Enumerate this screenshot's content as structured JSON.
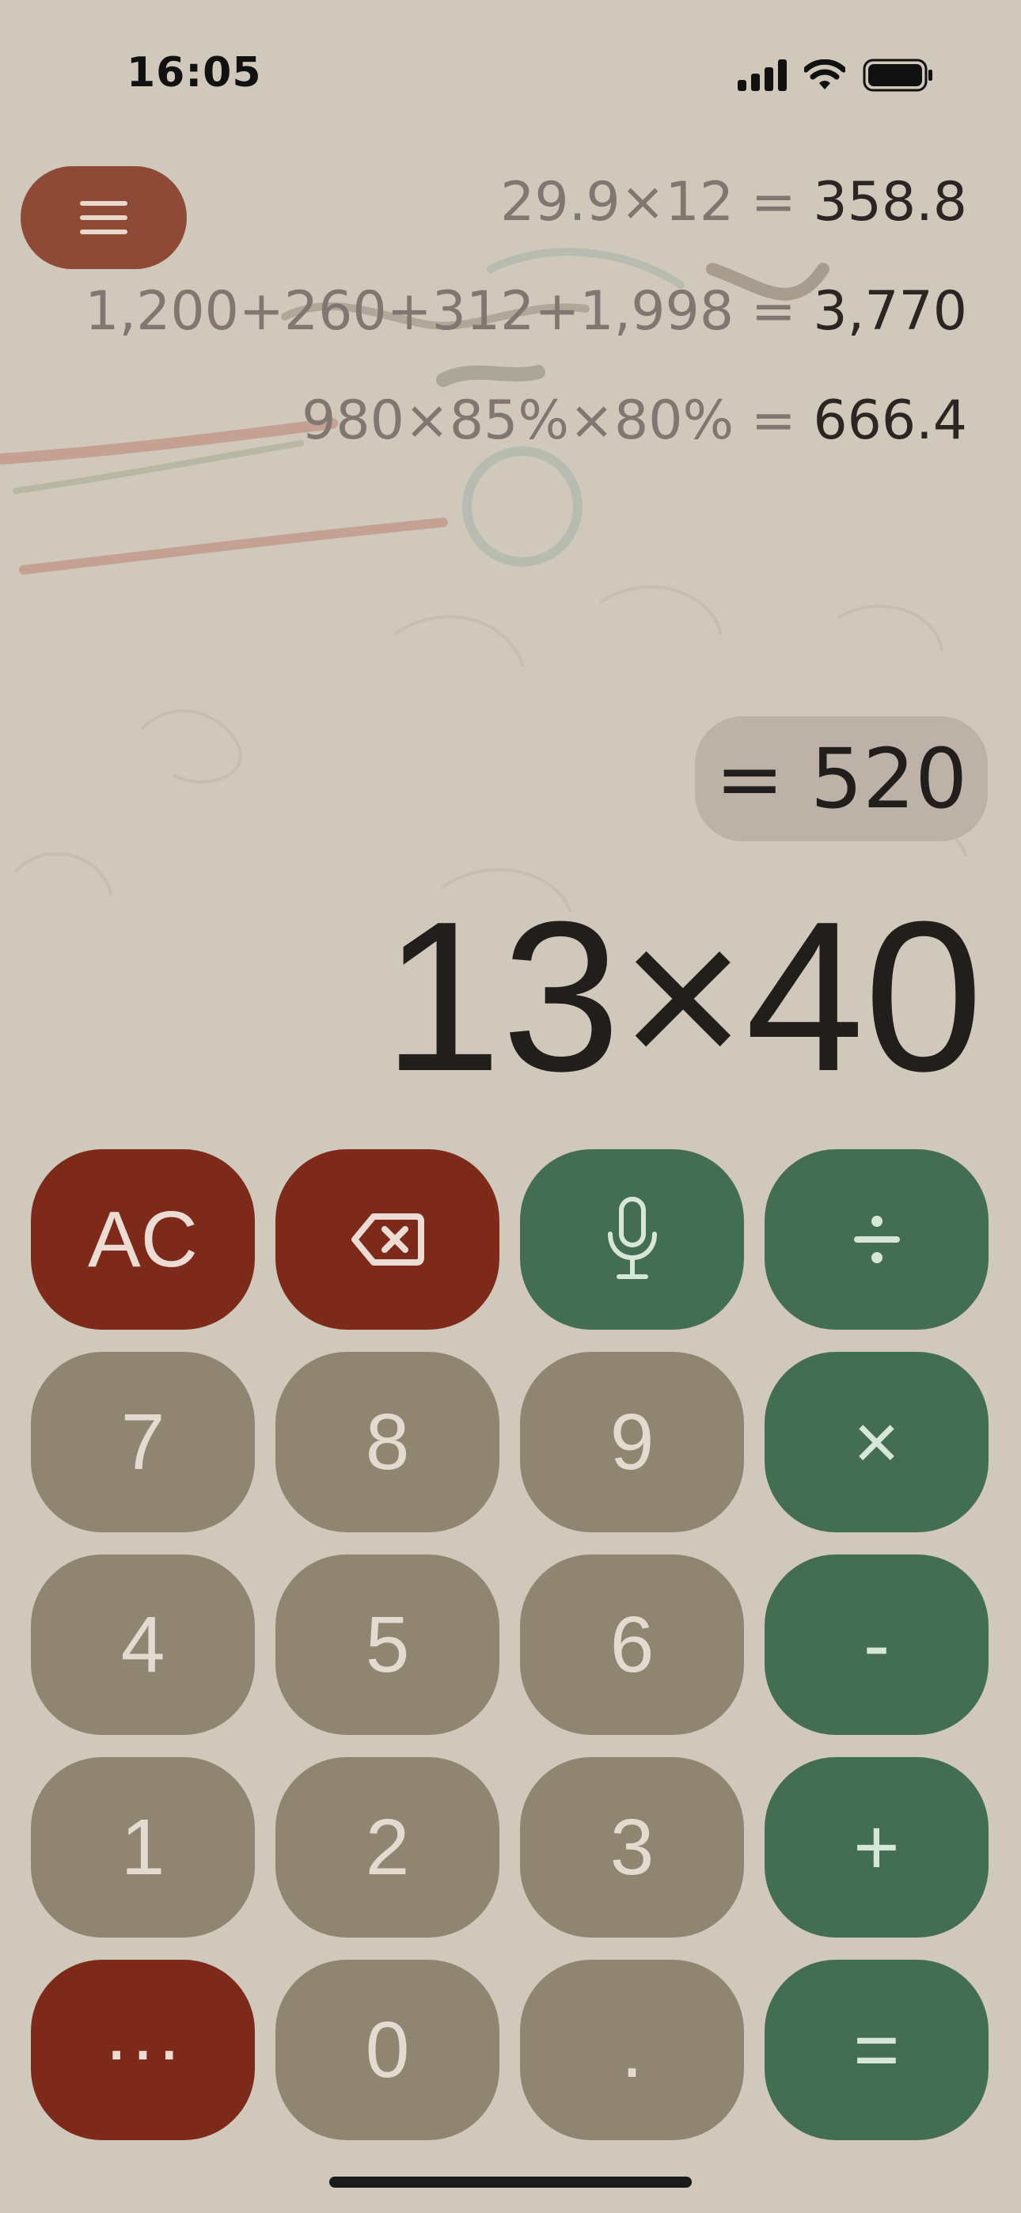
{
  "status_bar": {
    "time": "16:05"
  },
  "history": [
    {
      "expression": "29.9×12",
      "equals": "=",
      "result": "358.8"
    },
    {
      "expression": "1,200+260+312+1,998",
      "equals": "=",
      "result": "3,770"
    },
    {
      "expression": "980×85%×80%",
      "equals": "=",
      "result": "666.4"
    }
  ],
  "result_preview": "= 520",
  "expression": "13×40",
  "keys": {
    "ac": "AC",
    "seven": "7",
    "eight": "8",
    "nine": "9",
    "multiply": "×",
    "four": "4",
    "five": "5",
    "six": "6",
    "minus": "-",
    "one": "1",
    "two": "2",
    "three": "3",
    "plus": "+",
    "more": "···",
    "zero": "0",
    "decimal": ".",
    "equals": "="
  },
  "icons": {
    "menu": "hamburger-menu-icon",
    "backspace": "backspace-icon",
    "voice": "microphone-icon",
    "divide": "divide-icon"
  },
  "colors": {
    "background": "#d1c8bc",
    "function_red": "#7d2a1b",
    "operator_green": "#436e53",
    "digit_khaki": "#8f8570",
    "menu_button": "#8e4a36"
  }
}
